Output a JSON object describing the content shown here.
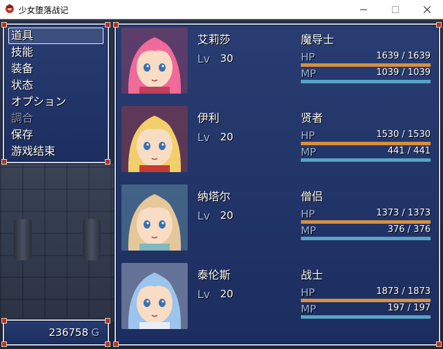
{
  "window": {
    "title": "少女堕落战记",
    "minimize_icon": "minimize-icon",
    "maximize_icon": "maximize-icon",
    "close_icon": "close-icon"
  },
  "menu": {
    "items": [
      {
        "label": "道具",
        "enabled": true
      },
      {
        "label": "技能",
        "enabled": true
      },
      {
        "label": "装备",
        "enabled": true
      },
      {
        "label": "状态",
        "enabled": true
      },
      {
        "label": "オプション",
        "enabled": true
      },
      {
        "label": "調合",
        "enabled": false
      },
      {
        "label": "保存",
        "enabled": true
      },
      {
        "label": "游戏结束",
        "enabled": true
      }
    ],
    "selected_index": 0
  },
  "gold": {
    "value": "236758",
    "unit": "G"
  },
  "labels": {
    "lv": "Lv",
    "hp": "HP",
    "mp": "MP"
  },
  "actors": [
    {
      "name": "艾莉莎",
      "level": "30",
      "class": "魔导士",
      "hp": "1639 / 1639",
      "mp": "1039 / 1039",
      "hp_ratio": 1.0,
      "mp_ratio": 1.0,
      "hair": "#f06a9a",
      "accent": "#c0405e"
    },
    {
      "name": "伊利",
      "level": "20",
      "class": "贤者",
      "hp": "1530 / 1530",
      "mp": "441 /  441",
      "hp_ratio": 1.0,
      "mp_ratio": 1.0,
      "hair": "#f2cf6a",
      "accent": "#c83a32"
    },
    {
      "name": "纳塔尔",
      "level": "20",
      "class": "僧侣",
      "hp": "1373 / 1373",
      "mp": "376 /  376",
      "hp_ratio": 1.0,
      "mp_ratio": 1.0,
      "hair": "#e6c79a",
      "accent": "#7fb8c0"
    },
    {
      "name": "泰伦斯",
      "level": "20",
      "class": "战士",
      "hp": "1873 / 1873",
      "mp": "197 /  197",
      "hp_ratio": 1.0,
      "mp_ratio": 1.0,
      "hair": "#9cc4ec",
      "accent": "#e8eef8"
    }
  ],
  "colors": {
    "hp_gauge": "#d9903e",
    "mp_gauge": "#58a4c8"
  }
}
